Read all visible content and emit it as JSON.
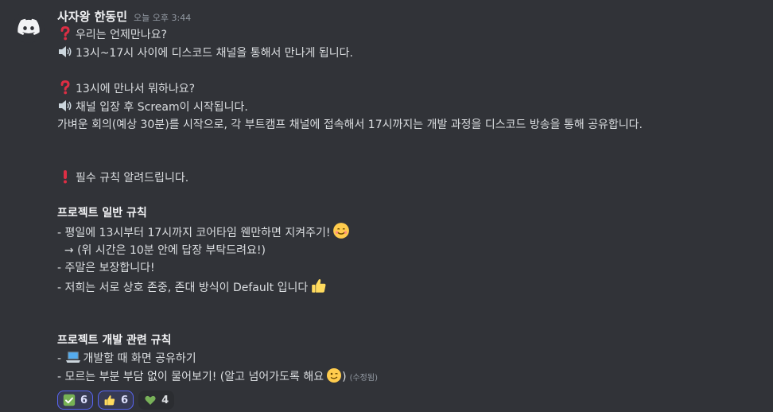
{
  "message": {
    "username": "사자왕 한동민",
    "timestamp": "오늘 오후 3:44",
    "edited_label": "(수정됨)",
    "lines": {
      "l1": "우리는 언제만나요?",
      "l2": "13시~17시 사이에 디스코드 채널을 통해서 만나게 됩니다.",
      "l4": "13시에 만나서 뭐하나요?",
      "l5": "채널 입장 후 Scream이 시작됩니다.",
      "l6": "가벼운 회의(예상 30분)를 시작으로, 각 부트캠프 채널에 접속해서 17시까지는 개발 과정을 디스코드 방송을 통해 공유합니다.",
      "l9": "필수 규칙 알려드립니다.",
      "l11": "프로젝트 일반 규칙",
      "l12": "- 평일에 13시부터 17시까지 코어타임 웬만하면 지켜주기!",
      "l13": "  → (위 시간은 10분 안에 답장 부탁드려요!)",
      "l14": "- 주말은 보장합니다!",
      "l15": "- 저희는 서로 상호 존중, 존대 방식이 Default 입니다",
      "l18": "프로젝트 개발 관련 규칙",
      "l19_prefix": "- ",
      "l19": "개발할 때 화면 공유하기",
      "l20": "- 모르는 부분 부담 없이 물어보기! (알고 넘어가도록 해요",
      "l20_suffix": ")"
    },
    "icons": {
      "question": "red-question-mark",
      "speaker": "speaker-high-volume",
      "exclamation": "red-exclamation-mark",
      "smile": "smiling-face",
      "thumbs": "thumbs-up",
      "laptop": "laptop",
      "wink": "winking-face"
    }
  },
  "reactions": [
    {
      "icon": "check-mark-button",
      "count": "6",
      "me": true
    },
    {
      "icon": "thumbs-up",
      "count": "6",
      "me": true
    },
    {
      "icon": "green-heart",
      "count": "4",
      "me": false
    }
  ],
  "colors": {
    "background": "#313338",
    "text": "#dbdee1",
    "accent": "#5865f2"
  }
}
